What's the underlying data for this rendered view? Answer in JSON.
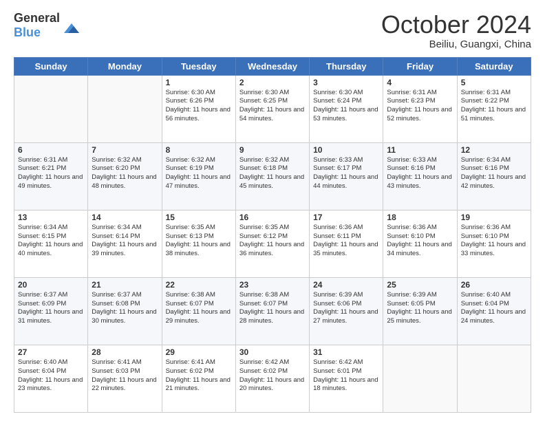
{
  "header": {
    "logo_general": "General",
    "logo_blue": "Blue",
    "month": "October 2024",
    "location": "Beiliu, Guangxi, China"
  },
  "weekdays": [
    "Sunday",
    "Monday",
    "Tuesday",
    "Wednesday",
    "Thursday",
    "Friday",
    "Saturday"
  ],
  "weeks": [
    [
      {
        "day": "",
        "sunrise": "",
        "sunset": "",
        "daylight": ""
      },
      {
        "day": "",
        "sunrise": "",
        "sunset": "",
        "daylight": ""
      },
      {
        "day": "1",
        "sunrise": "Sunrise: 6:30 AM",
        "sunset": "Sunset: 6:26 PM",
        "daylight": "Daylight: 11 hours and 56 minutes."
      },
      {
        "day": "2",
        "sunrise": "Sunrise: 6:30 AM",
        "sunset": "Sunset: 6:25 PM",
        "daylight": "Daylight: 11 hours and 54 minutes."
      },
      {
        "day": "3",
        "sunrise": "Sunrise: 6:30 AM",
        "sunset": "Sunset: 6:24 PM",
        "daylight": "Daylight: 11 hours and 53 minutes."
      },
      {
        "day": "4",
        "sunrise": "Sunrise: 6:31 AM",
        "sunset": "Sunset: 6:23 PM",
        "daylight": "Daylight: 11 hours and 52 minutes."
      },
      {
        "day": "5",
        "sunrise": "Sunrise: 6:31 AM",
        "sunset": "Sunset: 6:22 PM",
        "daylight": "Daylight: 11 hours and 51 minutes."
      }
    ],
    [
      {
        "day": "6",
        "sunrise": "Sunrise: 6:31 AM",
        "sunset": "Sunset: 6:21 PM",
        "daylight": "Daylight: 11 hours and 49 minutes."
      },
      {
        "day": "7",
        "sunrise": "Sunrise: 6:32 AM",
        "sunset": "Sunset: 6:20 PM",
        "daylight": "Daylight: 11 hours and 48 minutes."
      },
      {
        "day": "8",
        "sunrise": "Sunrise: 6:32 AM",
        "sunset": "Sunset: 6:19 PM",
        "daylight": "Daylight: 11 hours and 47 minutes."
      },
      {
        "day": "9",
        "sunrise": "Sunrise: 6:32 AM",
        "sunset": "Sunset: 6:18 PM",
        "daylight": "Daylight: 11 hours and 45 minutes."
      },
      {
        "day": "10",
        "sunrise": "Sunrise: 6:33 AM",
        "sunset": "Sunset: 6:17 PM",
        "daylight": "Daylight: 11 hours and 44 minutes."
      },
      {
        "day": "11",
        "sunrise": "Sunrise: 6:33 AM",
        "sunset": "Sunset: 6:16 PM",
        "daylight": "Daylight: 11 hours and 43 minutes."
      },
      {
        "day": "12",
        "sunrise": "Sunrise: 6:34 AM",
        "sunset": "Sunset: 6:16 PM",
        "daylight": "Daylight: 11 hours and 42 minutes."
      }
    ],
    [
      {
        "day": "13",
        "sunrise": "Sunrise: 6:34 AM",
        "sunset": "Sunset: 6:15 PM",
        "daylight": "Daylight: 11 hours and 40 minutes."
      },
      {
        "day": "14",
        "sunrise": "Sunrise: 6:34 AM",
        "sunset": "Sunset: 6:14 PM",
        "daylight": "Daylight: 11 hours and 39 minutes."
      },
      {
        "day": "15",
        "sunrise": "Sunrise: 6:35 AM",
        "sunset": "Sunset: 6:13 PM",
        "daylight": "Daylight: 11 hours and 38 minutes."
      },
      {
        "day": "16",
        "sunrise": "Sunrise: 6:35 AM",
        "sunset": "Sunset: 6:12 PM",
        "daylight": "Daylight: 11 hours and 36 minutes."
      },
      {
        "day": "17",
        "sunrise": "Sunrise: 6:36 AM",
        "sunset": "Sunset: 6:11 PM",
        "daylight": "Daylight: 11 hours and 35 minutes."
      },
      {
        "day": "18",
        "sunrise": "Sunrise: 6:36 AM",
        "sunset": "Sunset: 6:10 PM",
        "daylight": "Daylight: 11 hours and 34 minutes."
      },
      {
        "day": "19",
        "sunrise": "Sunrise: 6:36 AM",
        "sunset": "Sunset: 6:10 PM",
        "daylight": "Daylight: 11 hours and 33 minutes."
      }
    ],
    [
      {
        "day": "20",
        "sunrise": "Sunrise: 6:37 AM",
        "sunset": "Sunset: 6:09 PM",
        "daylight": "Daylight: 11 hours and 31 minutes."
      },
      {
        "day": "21",
        "sunrise": "Sunrise: 6:37 AM",
        "sunset": "Sunset: 6:08 PM",
        "daylight": "Daylight: 11 hours and 30 minutes."
      },
      {
        "day": "22",
        "sunrise": "Sunrise: 6:38 AM",
        "sunset": "Sunset: 6:07 PM",
        "daylight": "Daylight: 11 hours and 29 minutes."
      },
      {
        "day": "23",
        "sunrise": "Sunrise: 6:38 AM",
        "sunset": "Sunset: 6:07 PM",
        "daylight": "Daylight: 11 hours and 28 minutes."
      },
      {
        "day": "24",
        "sunrise": "Sunrise: 6:39 AM",
        "sunset": "Sunset: 6:06 PM",
        "daylight": "Daylight: 11 hours and 27 minutes."
      },
      {
        "day": "25",
        "sunrise": "Sunrise: 6:39 AM",
        "sunset": "Sunset: 6:05 PM",
        "daylight": "Daylight: 11 hours and 25 minutes."
      },
      {
        "day": "26",
        "sunrise": "Sunrise: 6:40 AM",
        "sunset": "Sunset: 6:04 PM",
        "daylight": "Daylight: 11 hours and 24 minutes."
      }
    ],
    [
      {
        "day": "27",
        "sunrise": "Sunrise: 6:40 AM",
        "sunset": "Sunset: 6:04 PM",
        "daylight": "Daylight: 11 hours and 23 minutes."
      },
      {
        "day": "28",
        "sunrise": "Sunrise: 6:41 AM",
        "sunset": "Sunset: 6:03 PM",
        "daylight": "Daylight: 11 hours and 22 minutes."
      },
      {
        "day": "29",
        "sunrise": "Sunrise: 6:41 AM",
        "sunset": "Sunset: 6:02 PM",
        "daylight": "Daylight: 11 hours and 21 minutes."
      },
      {
        "day": "30",
        "sunrise": "Sunrise: 6:42 AM",
        "sunset": "Sunset: 6:02 PM",
        "daylight": "Daylight: 11 hours and 20 minutes."
      },
      {
        "day": "31",
        "sunrise": "Sunrise: 6:42 AM",
        "sunset": "Sunset: 6:01 PM",
        "daylight": "Daylight: 11 hours and 18 minutes."
      },
      {
        "day": "",
        "sunrise": "",
        "sunset": "",
        "daylight": ""
      },
      {
        "day": "",
        "sunrise": "",
        "sunset": "",
        "daylight": ""
      }
    ]
  ]
}
